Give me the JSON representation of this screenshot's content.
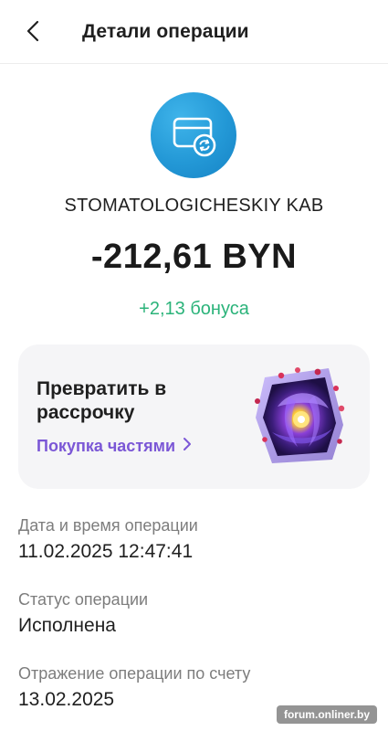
{
  "header": {
    "title": "Детали операции",
    "back_icon": "chevron-left-icon"
  },
  "operation": {
    "icon": "card-refresh-icon",
    "merchant": "STOMATOLOGICHESKIY KAB",
    "amount": "-212,61 BYN",
    "bonus": "+2,13 бонуса"
  },
  "installment_card": {
    "title": "Превратить в рассрочку",
    "link_label": "Покупка частями",
    "link_icon": "chevron-right-icon",
    "art_icon": "crystal-cube-illustration"
  },
  "details": [
    {
      "label": "Дата и время операции",
      "value": "11.02.2025 12:47:41"
    },
    {
      "label": "Статус операции",
      "value": "Исполнена"
    },
    {
      "label": "Отражение операции по счету",
      "value": "13.02.2025"
    }
  ],
  "watermark": "forum.onliner.by",
  "colors": {
    "accent_blue": "#2398d6",
    "bonus_green": "#2bb37a",
    "link_purple": "#7b57d6",
    "card_bg": "#f5f5f7"
  }
}
